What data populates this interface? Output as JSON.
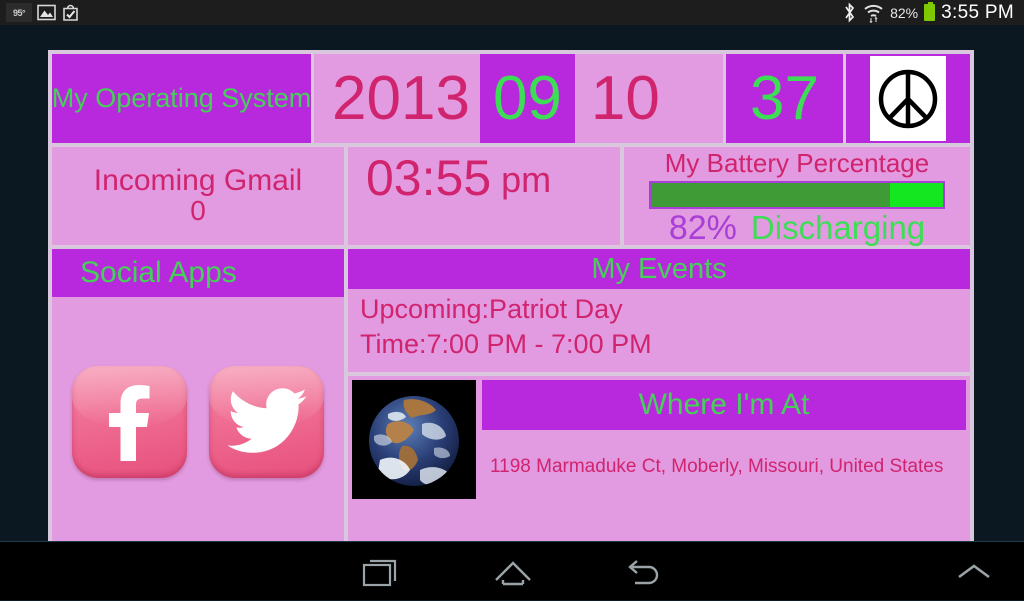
{
  "statusbar": {
    "left_icons": [
      {
        "name": "temperature-icon",
        "label": "95°"
      },
      {
        "name": "gallery-image-icon",
        "label": ""
      },
      {
        "name": "shopping-bag-check-icon",
        "label": ""
      }
    ],
    "bluetooth_icon": "bluetooth-icon",
    "wifi_icon": "wifi-icon",
    "battery_percent": "82%",
    "battery_icon": "battery-icon",
    "clock": "3:55 PM"
  },
  "widget": {
    "os_label": "My Operating System",
    "date": {
      "year": "2013",
      "month": "09",
      "day": "10",
      "week": "37"
    },
    "peace_icon": "peace-sign-icon",
    "gmail": {
      "title": "Incoming Gmail",
      "count": "0"
    },
    "social": {
      "title": "Social Apps",
      "apps": [
        {
          "name": "facebook-app-icon",
          "label": "f"
        },
        {
          "name": "twitter-app-icon",
          "label": ""
        }
      ]
    },
    "clock": {
      "time": "03:55",
      "ampm": "pm"
    },
    "battery": {
      "title": "My Battery Percentage",
      "percent": "82%",
      "percent_value": 82,
      "status": "Discharging"
    },
    "events": {
      "title": "My Events",
      "upcoming": "Upcoming:Patriot Day",
      "time": "Time:7:00 PM - 7:00 PM"
    },
    "location": {
      "title": "Where I'm At",
      "address": "1198 Marmaduke Ct, Moberly, Missouri, United States",
      "globe_icon": "earth-globe-image"
    }
  },
  "navbar": {
    "recent_label": "recent-apps",
    "home_label": "home",
    "back_label": "back",
    "expand_label": "expand-up"
  },
  "colors": {
    "header_purple": "#b829dd",
    "panel_pink": "#e29ae0",
    "accent_green": "#45d158",
    "accent_crimson": "#d1246e",
    "border_lavender": "#d9c7dd",
    "desktop": "#0b1721"
  }
}
